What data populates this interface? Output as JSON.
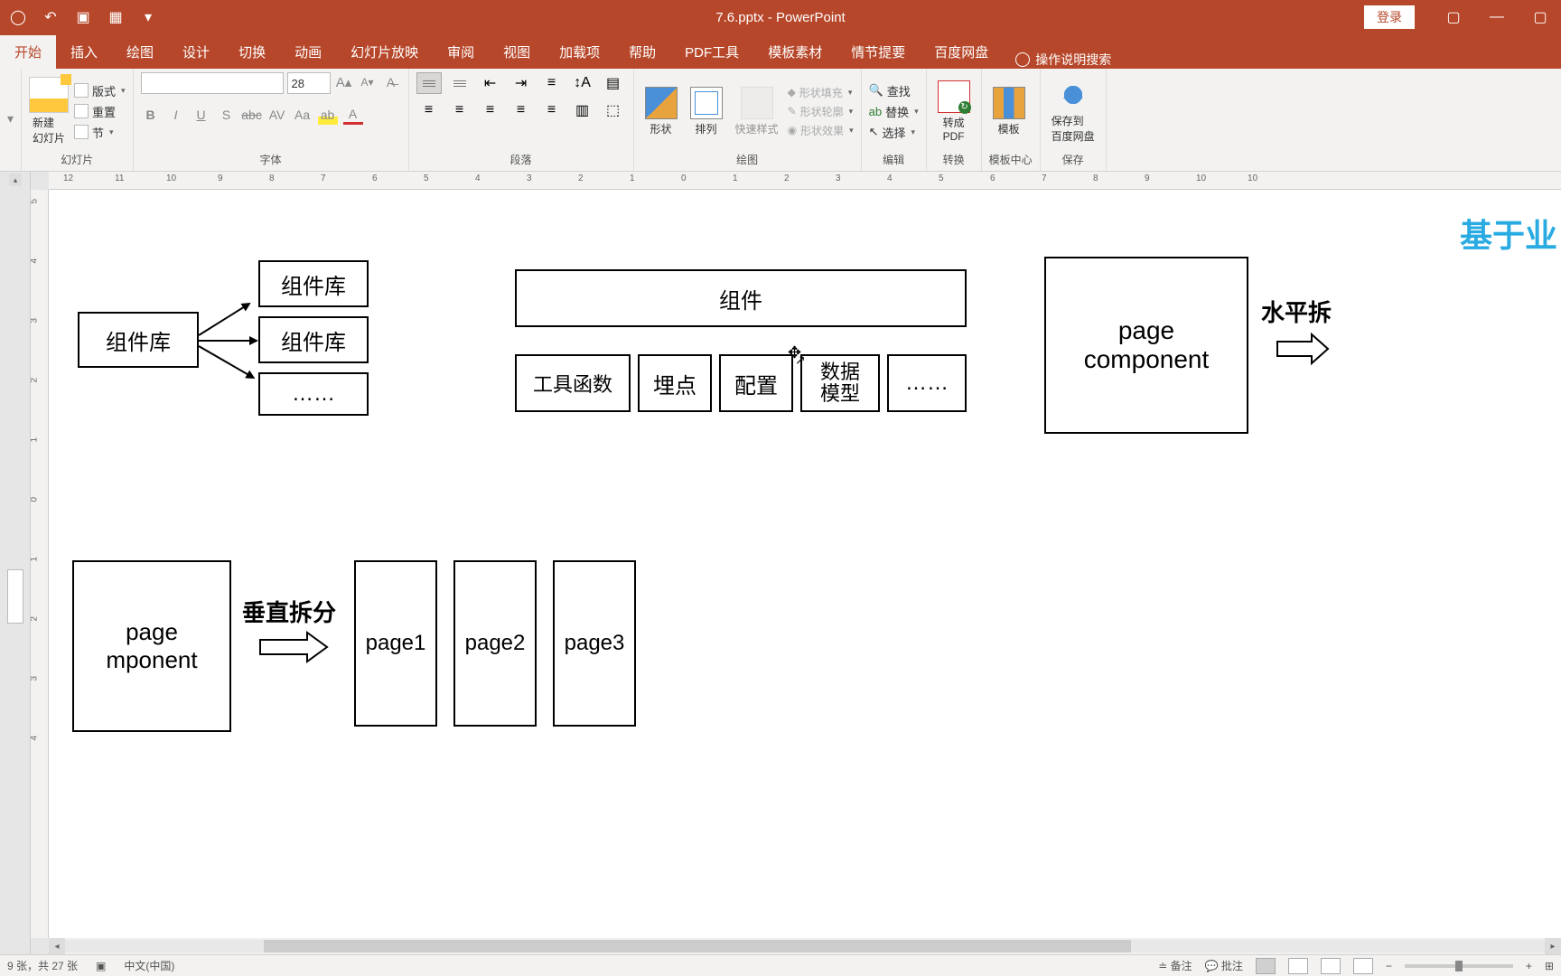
{
  "titlebar": {
    "title": "7.6.pptx - PowerPoint",
    "login": "登录"
  },
  "tabs": {
    "home": "开始",
    "insert": "插入",
    "draw": "绘图",
    "design": "设计",
    "transitions": "切换",
    "animations": "动画",
    "slideshow": "幻灯片放映",
    "review": "审阅",
    "view": "视图",
    "addins": "加载项",
    "help": "帮助",
    "pdf": "PDF工具",
    "templates": "模板素材",
    "story": "情节提要",
    "baidu": "百度网盘",
    "tellme": "操作说明搜索"
  },
  "ribbon": {
    "newslide": "新建\n幻灯片",
    "layout": "版式",
    "reset": "重置",
    "section": "节",
    "slides_label": "幻灯片",
    "fontsize": "28",
    "font_label": "字体",
    "para_label": "段落",
    "shapes": "形状",
    "arrange": "排列",
    "quickstyles": "快速样式",
    "shapefill": "形状填充",
    "shapeoutline": "形状轮廓",
    "shapeeffects": "形状效果",
    "drawing_label": "绘图",
    "find": "查找",
    "replace": "替换",
    "select": "选择",
    "editing_label": "编辑",
    "topdf": "转成\nPDF",
    "convert_label": "转换",
    "template": "模板",
    "template_label": "模板中心",
    "savebaidu": "保存到\n百度网盘",
    "save_label": "保存"
  },
  "slide": {
    "heading": "基于业",
    "complib": "组件库",
    "complib1": "组件库",
    "complib2": "组件库",
    "dots": "……",
    "component": "组件",
    "util": "工具函数",
    "track": "埋点",
    "config": "配置",
    "datamodel": "数据\n模型",
    "dots2": "……",
    "pagecomp": "page\ncomponent",
    "horiz": "水平拆",
    "pagecomp2": "page\nmponent",
    "vert": "垂直拆分",
    "page1": "page1",
    "page2": "page2",
    "page3": "page3"
  },
  "ruler": {
    "h": [
      "12",
      "11",
      "10",
      "9",
      "8",
      "7",
      "6",
      "5",
      "4",
      "3",
      "2",
      "1",
      "0",
      "1",
      "2",
      "3",
      "4",
      "5",
      "6",
      "7",
      "8",
      "9",
      "10",
      "10"
    ],
    "v": [
      "5",
      "4",
      "3",
      "2",
      "1",
      "0",
      "1",
      "2",
      "3",
      "4"
    ]
  },
  "status": {
    "slideinfo": "9 张，共 27 张",
    "lang": "中文(中国)",
    "notes": "备注",
    "comments": "批注"
  }
}
